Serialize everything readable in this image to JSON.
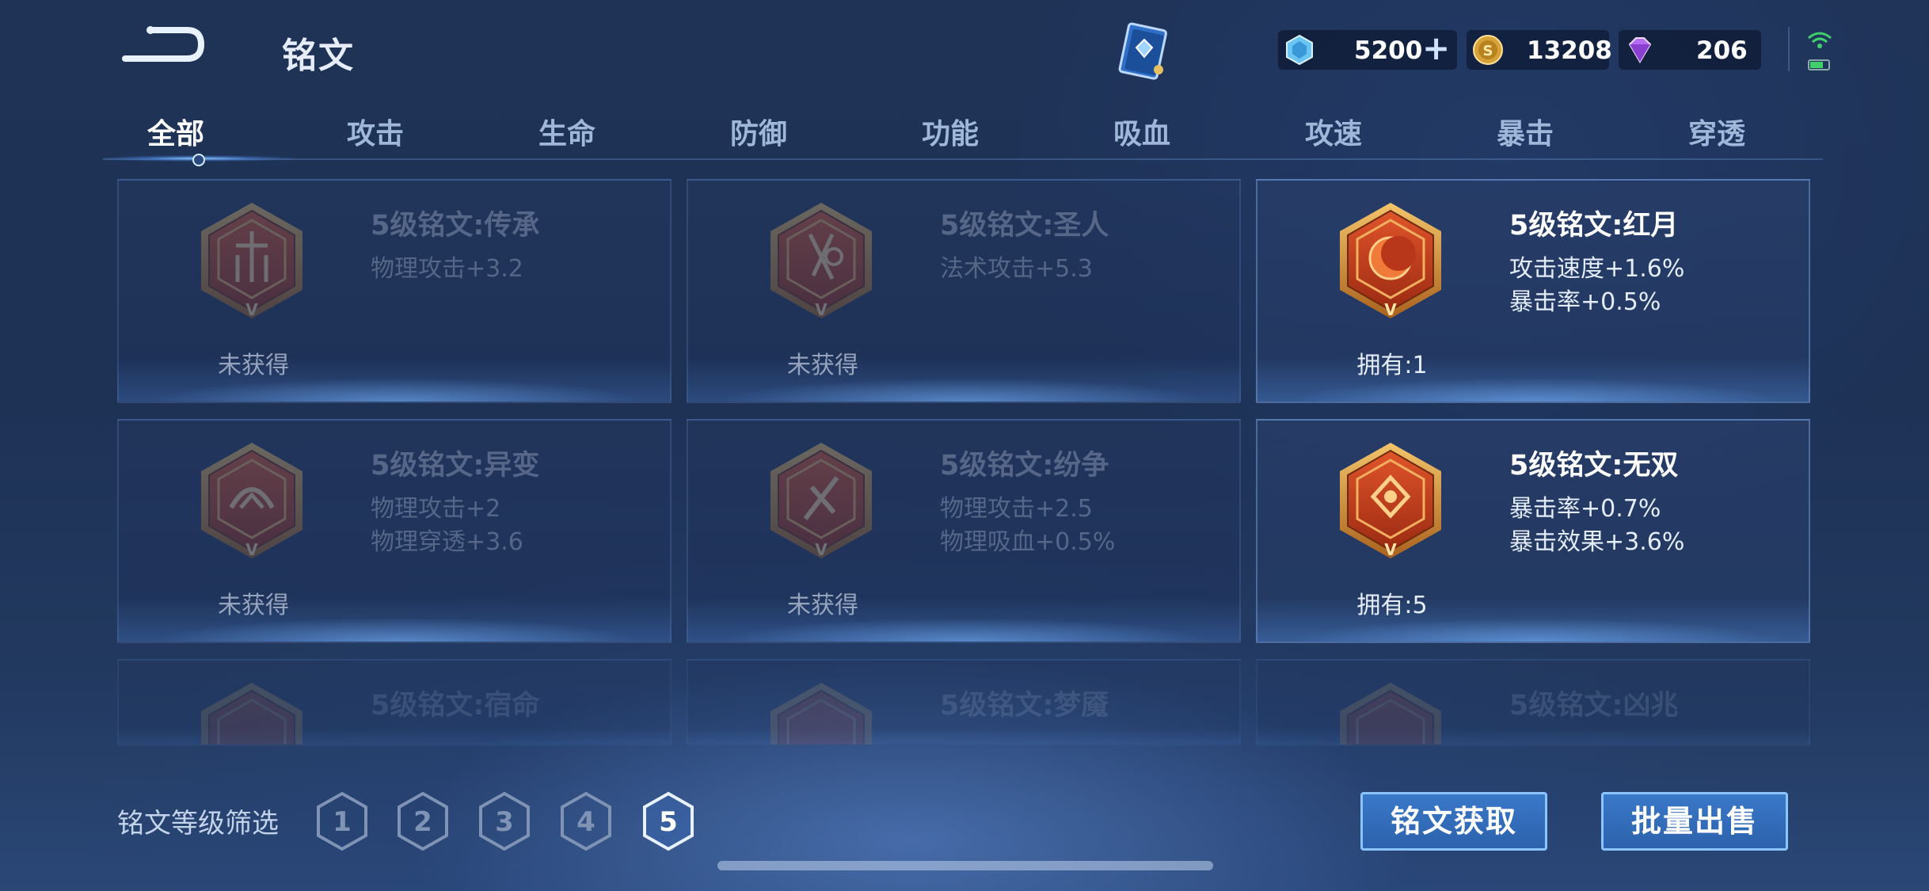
{
  "header": {
    "title": "铭文"
  },
  "currency": [
    {
      "icon": "diamond-icon",
      "value": "5200",
      "plus": "+"
    },
    {
      "icon": "gold-coin-icon",
      "value": "13208"
    },
    {
      "icon": "purple-gem-icon",
      "value": "206"
    }
  ],
  "tabs": [
    {
      "label": "全部",
      "active": true
    },
    {
      "label": "攻击"
    },
    {
      "label": "生命"
    },
    {
      "label": "防御"
    },
    {
      "label": "功能"
    },
    {
      "label": "吸血"
    },
    {
      "label": "攻速"
    },
    {
      "label": "暴击"
    },
    {
      "label": "穿透"
    }
  ],
  "cards": [
    {
      "name": "5级铭文:传承",
      "stat1": "物理攻击+3.2",
      "stat2": "",
      "status": "未获得",
      "owned": false
    },
    {
      "name": "5级铭文:圣人",
      "stat1": "法术攻击+5.3",
      "stat2": "",
      "status": "未获得",
      "owned": false
    },
    {
      "name": "5级铭文:红月",
      "stat1": "攻击速度+1.6%",
      "stat2": "暴击率+0.5%",
      "status": "拥有:1",
      "owned": true
    },
    {
      "name": "5级铭文:异变",
      "stat1": "物理攻击+2",
      "stat2": "物理穿透+3.6",
      "status": "未获得",
      "owned": false
    },
    {
      "name": "5级铭文:纷争",
      "stat1": "物理攻击+2.5",
      "stat2": "物理吸血+0.5%",
      "status": "未获得",
      "owned": false
    },
    {
      "name": "5级铭文:无双",
      "stat1": "暴击率+0.7%",
      "stat2": "暴击效果+3.6%",
      "status": "拥有:5",
      "owned": true
    },
    {
      "name": "5级铭文:宿命",
      "stat1": "",
      "stat2": "",
      "status": "",
      "owned": false
    },
    {
      "name": "5级铭文:梦魇",
      "stat1": "",
      "stat2": "",
      "status": "",
      "owned": false
    },
    {
      "name": "5级铭文:凶兆",
      "stat1": "",
      "stat2": "",
      "status": "",
      "owned": false
    }
  ],
  "filter": {
    "label": "铭文等级筛选",
    "levels": [
      "1",
      "2",
      "3",
      "4",
      "5"
    ],
    "selected": "5"
  },
  "buttons": {
    "get": "铭文获取",
    "sell": "批量出售"
  },
  "colors": {
    "accent": "#8cc4ff",
    "button": "#2c62ad",
    "rune_red": "#c8401e",
    "rune_gold": "#e0a040"
  }
}
